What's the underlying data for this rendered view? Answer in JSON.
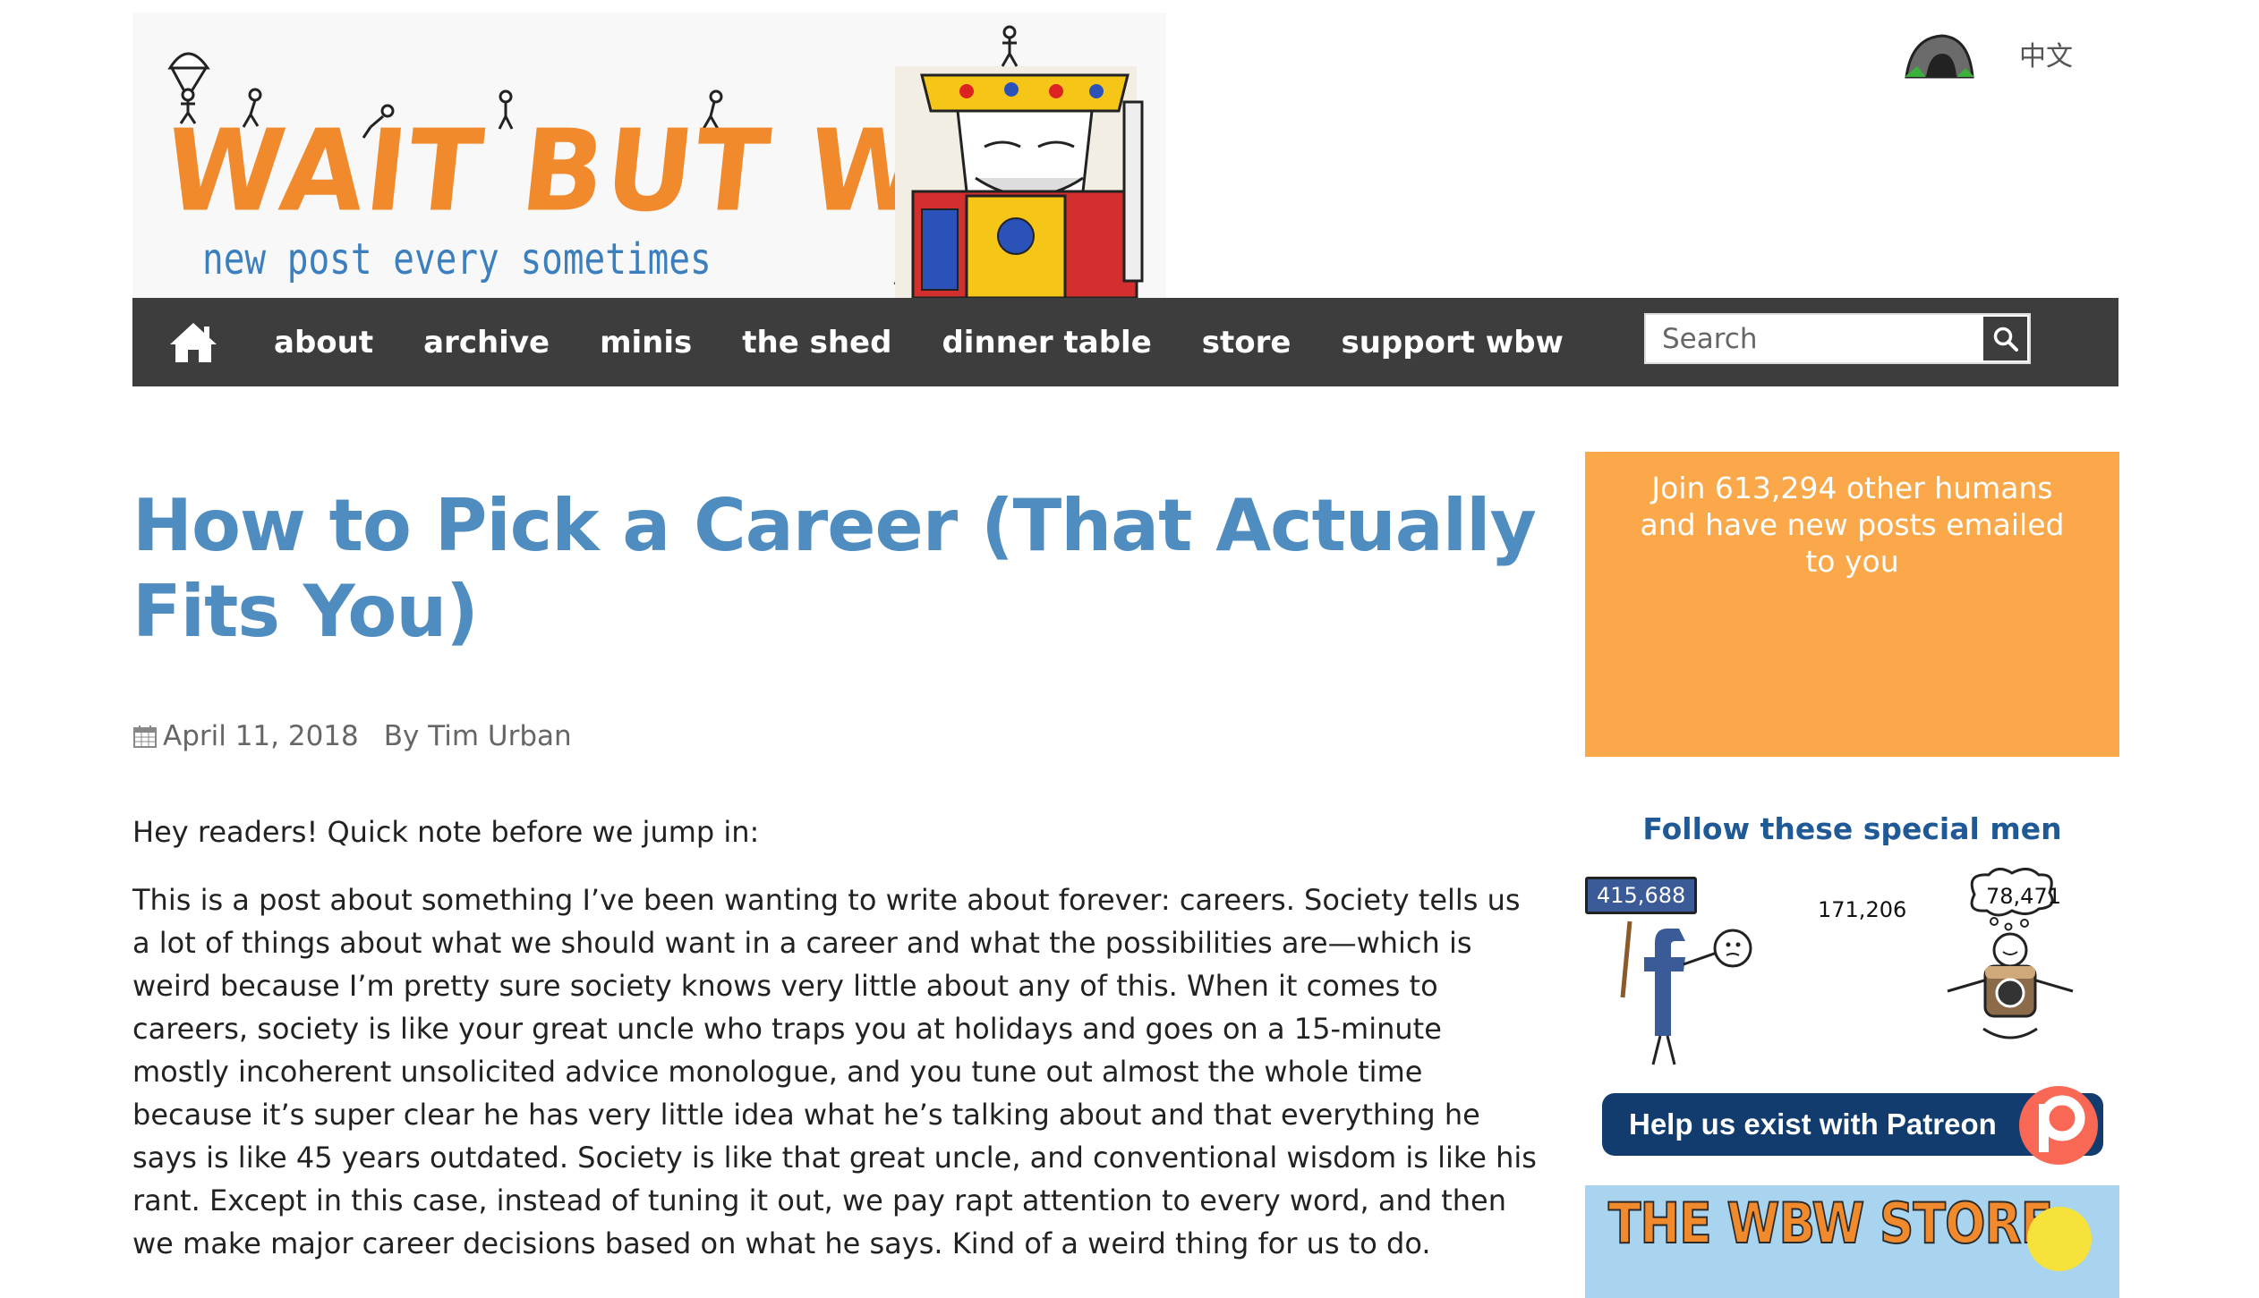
{
  "header": {
    "logo_title": "WAIT BUT WHY",
    "logo_tagline": "new post every sometimes",
    "language_link": "中文"
  },
  "nav": {
    "items": [
      "about",
      "archive",
      "minis",
      "the shed",
      "dinner table",
      "store",
      "support wbw"
    ],
    "search_placeholder": "Search"
  },
  "post": {
    "title": "How to Pick a Career (That Actually Fits You)",
    "date": "April 11, 2018",
    "author": "By Tim Urban",
    "intro": "Hey readers! Quick note before we jump in:",
    "body": "This is a post about something I’ve been wanting to write about forever: careers. Society tells us a lot of things about what we should want in a career and what the possibilities are—which is weird because I’m pretty sure society knows very little about any of this. When it comes to careers, society is like your great uncle who traps you at holidays and goes on a 15-minute mostly incoherent unsolicited advice monologue, and you tune out almost the whole time because it’s super clear he has very little idea what he’s talking about and that everything he says is like 45 years outdated. Society is like that great uncle, and conventional wisdom is like his rant. Except in this case, instead of tuning it out, we pay rapt attention to every word, and then we make major career decisions based on what he says. Kind of a weird thing for us to do."
  },
  "sidebar": {
    "subscribe_text": "Join 613,294 other humans and have new posts emailed to you",
    "follow_title": "Follow these special men",
    "facebook_count": "415,688",
    "twitter_count": "171,206",
    "instagram_count": "78,471",
    "patreon_label": "Help us exist with Patreon",
    "store_title": "THE WBW STORE"
  },
  "colors": {
    "logo_orange": "#f08a2d",
    "logo_blue": "#3b7fbf",
    "nav_bg": "#3d3d3d",
    "title_blue": "#4f8cc0",
    "subscribe_orange": "#faa84a",
    "follow_blue": "#1f5a96",
    "patreon_navy": "#123c6e",
    "store_sky": "#a9d4ef"
  },
  "icons": [
    "home-icon",
    "search-icon",
    "calendar-icon",
    "cave-icon",
    "facebook-icon",
    "instagram-icon",
    "patreon-icon"
  ]
}
